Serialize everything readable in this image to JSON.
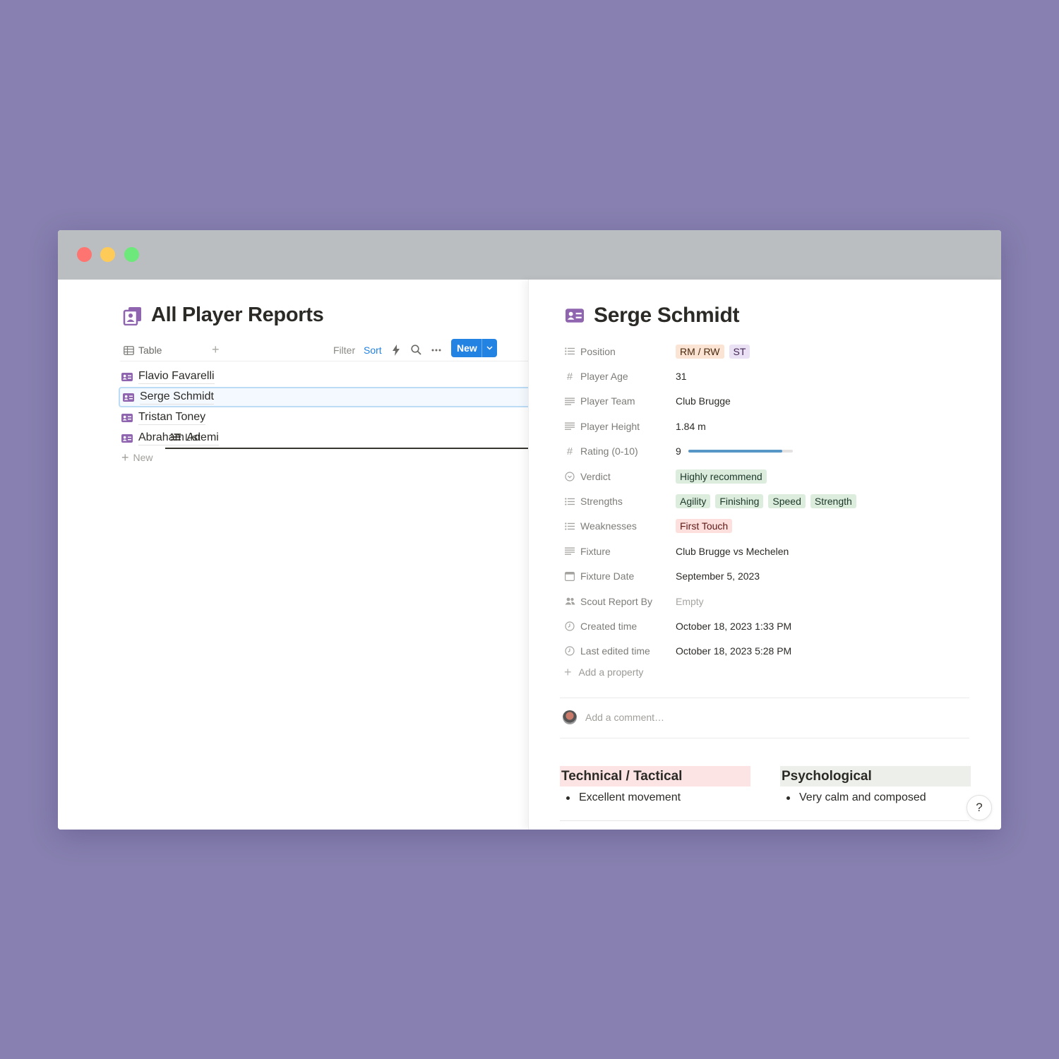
{
  "colors": {
    "background": "#8780b0",
    "accent": "#2383e2",
    "icon_purple": "#9065b0"
  },
  "database": {
    "title": "All Player Reports",
    "views": [
      {
        "label": "Table",
        "icon": "table-icon"
      },
      {
        "label": "List",
        "icon": "list-icon",
        "active": true
      }
    ],
    "toolbar": {
      "filter": "Filter",
      "sort": "Sort",
      "new": "New"
    },
    "items": [
      {
        "name": "Flavio Favarelli"
      },
      {
        "name": "Serge Schmidt",
        "selected": true
      },
      {
        "name": "Tristan Toney"
      },
      {
        "name": "Abraham Ademi"
      }
    ],
    "new_label": "New"
  },
  "page": {
    "title": "Serge Schmidt",
    "properties": {
      "position": {
        "label": "Position",
        "tags": [
          "RM / RW",
          "ST"
        ]
      },
      "age": {
        "label": "Player Age",
        "value": "31"
      },
      "team": {
        "label": "Player Team",
        "value": "Club Brugge"
      },
      "height": {
        "label": "Player Height",
        "value": "1.84 m"
      },
      "rating": {
        "label": "Rating (0-10)",
        "value": "9",
        "fraction": 0.9
      },
      "verdict": {
        "label": "Verdict",
        "value": "Highly recommend"
      },
      "strengths": {
        "label": "Strengths",
        "tags": [
          "Agility",
          "Finishing",
          "Speed",
          "Strength"
        ]
      },
      "weaknesses": {
        "label": "Weaknesses",
        "tags": [
          "First Touch"
        ]
      },
      "fixture": {
        "label": "Fixture",
        "value": "Club Brugge vs Mechelen"
      },
      "fixture_date": {
        "label": "Fixture Date",
        "value": "September 5, 2023"
      },
      "scout": {
        "label": "Scout Report By",
        "value": "Empty"
      },
      "created": {
        "label": "Created time",
        "value": "October 18, 2023 1:33 PM"
      },
      "edited": {
        "label": "Last edited time",
        "value": "October 18, 2023 5:28 PM"
      }
    },
    "add_property": "Add a property",
    "comment_placeholder": "Add a comment…",
    "sections": [
      {
        "title": "Technical / Tactical",
        "bullets": [
          "Excellent movement"
        ]
      },
      {
        "title": "Psychological",
        "bullets": [
          "Very calm and composed"
        ]
      }
    ],
    "help": "?"
  }
}
